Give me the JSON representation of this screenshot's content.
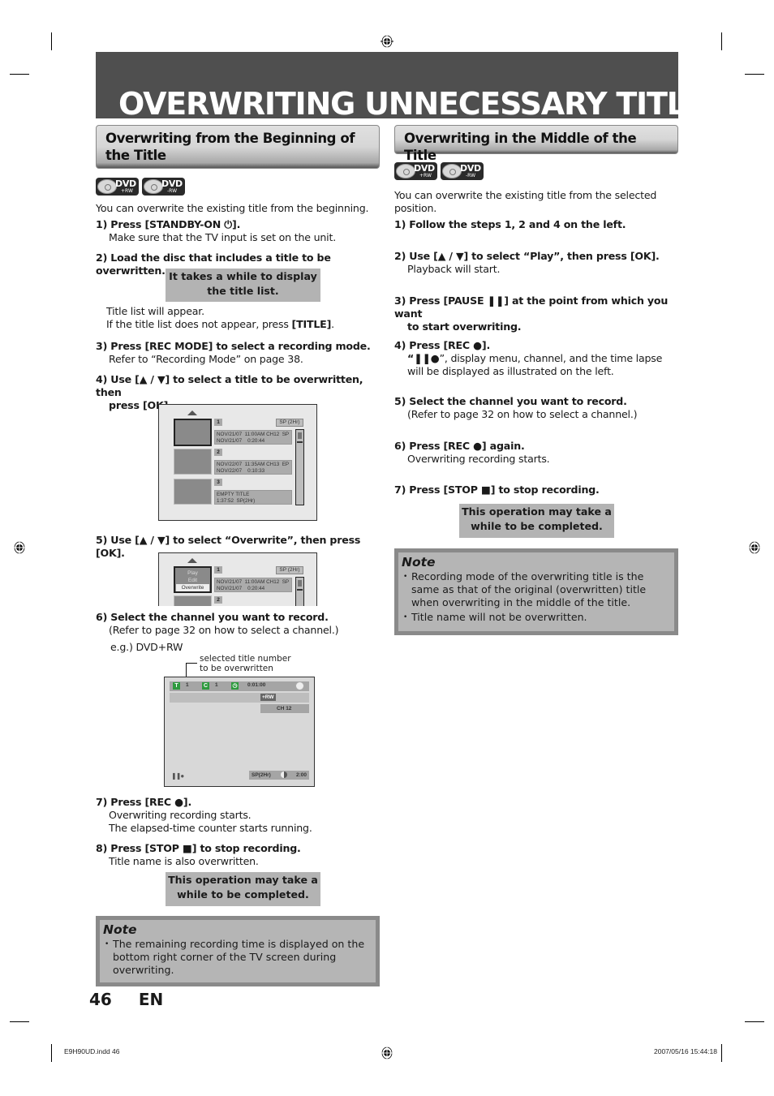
{
  "page_title": "OVERWRITING UNNECESSARY TITLE",
  "left": {
    "heading": "Overwriting from the Beginning of the Title",
    "disc_logos": [
      {
        "label": "DVD",
        "sub": "+RW"
      },
      {
        "label": "DVD",
        "sub": "-RW"
      }
    ],
    "intro": "You can overwrite the existing title from the beginning.",
    "step1": {
      "title": "1) Press [STANDBY-ON ⏻].",
      "text": "Make sure that the TV input is set on the unit."
    },
    "step2": {
      "title": "2) Load the disc that includes a title to be overwritten."
    },
    "box1": {
      "line1": "It takes a while to display",
      "line2": "the title list."
    },
    "step2_text1": "Title list will appear.",
    "step2_text2_pre": "If the title list does not appear, press ",
    "step2_text2_bold": "[TITLE]",
    "step2_text2_post": ".",
    "step3": {
      "title": "3) Press [REC MODE] to select a recording mode.",
      "text": "Refer to “Recording Mode” on page 38."
    },
    "step4": {
      "title_l1": "4) Use [▲ / ▼] to select a title to be overwritten, then",
      "title_l2": "press [OK]."
    },
    "title_list": {
      "mode": "SP (2Hr)",
      "items": [
        {
          "num": "1",
          "info": "NOV/21/07  11:00AM CH12  SP\nNOV/21/07    0:20:44"
        },
        {
          "num": "2",
          "info": "NOV/22/07  11:35AM CH13  EP\nNOV/22/07    0:10:33"
        },
        {
          "num": "3",
          "info": "EMPTY TITLE\n1:37:52  SP(2Hr)"
        }
      ]
    },
    "step5": {
      "title": "5) Use [▲ / ▼] to select “Overwrite”, then press [OK]."
    },
    "menu_screen": {
      "menu": [
        "Play",
        "Edit",
        "Overwrite"
      ],
      "selected": "Overwrite",
      "num1": "1",
      "num2": "2",
      "mode": "SP (2Hr)",
      "info": "NOV/21/07  11:00AM CH12  SP\nNOV/21/07    0:20:44"
    },
    "step6": {
      "title": "6) Select the channel you want to record.",
      "text": "(Refer to page 32 on how to select a channel.)",
      "eg": "e.g.) DVD+RW"
    },
    "osd": {
      "callout_l1": "selected title number",
      "callout_l2": "to be overwritten",
      "title_icon": "T",
      "title_num": "1",
      "chapter_icon": "C",
      "chapter_num": "1",
      "clock_icon": "◷",
      "time": "0:01:00",
      "disc_type": "+RW",
      "channel": "CH   12",
      "status": "❚❚●",
      "rec_mode": "SP(2Hr)",
      "remaining": "2:00"
    },
    "step7": {
      "title": "7) Press [REC ●].",
      "text1": "Overwriting recording starts.",
      "text2": "The elapsed-time counter starts running."
    },
    "step8": {
      "title": "8) Press [STOP ■] to stop recording.",
      "text": "Title name is also overwritten."
    },
    "box2": {
      "line1": "This operation may take a",
      "line2": "while to be completed."
    },
    "note": {
      "title": "Note",
      "items": [
        "The remaining recording time is displayed on the bottom right corner of the TV screen during overwriting."
      ]
    }
  },
  "right": {
    "heading": "Overwriting in the Middle of the Title",
    "disc_logos": [
      {
        "label": "DVD",
        "sub": "+RW"
      },
      {
        "label": "DVD",
        "sub": "-RW"
      }
    ],
    "intro": "You can overwrite the existing title from the selected position.",
    "step1": {
      "title": "1) Follow the steps 1, 2 and 4 on the left."
    },
    "step2": {
      "title": "2) Use [▲ / ▼] to select “Play”, then press [OK].",
      "text": "Playback will start."
    },
    "step3": {
      "title_l1": "3) Press [PAUSE ❚❚] at the point from which you want",
      "title_l2": "to start overwriting."
    },
    "step4": {
      "title": "4) Press [REC ●].",
      "text_bold": "“❚❚●",
      "text": "”, display menu, channel, and the time lapse will be displayed as illustrated on the left."
    },
    "step5": {
      "title": "5) Select the channel you want to record.",
      "text": "(Refer to page 32 on how to select a channel.)"
    },
    "step6": {
      "title": "6) Press [REC ●] again.",
      "text": "Overwriting recording starts."
    },
    "step7": {
      "title": "7) Press [STOP ■] to stop recording."
    },
    "box": {
      "line1": "This operation may take a",
      "line2": "while to be completed."
    },
    "note": {
      "title": "Note",
      "items": [
        "Recording mode of the overwriting title is the same as that of the original (overwritten) title when overwriting in the middle of the title.",
        "Title name will not be overwritten."
      ]
    }
  },
  "page_number": "46",
  "language": "EN",
  "footer": {
    "file": "E9H90UD.indd   46",
    "timestamp": "2007/05/16   15:44:18"
  }
}
